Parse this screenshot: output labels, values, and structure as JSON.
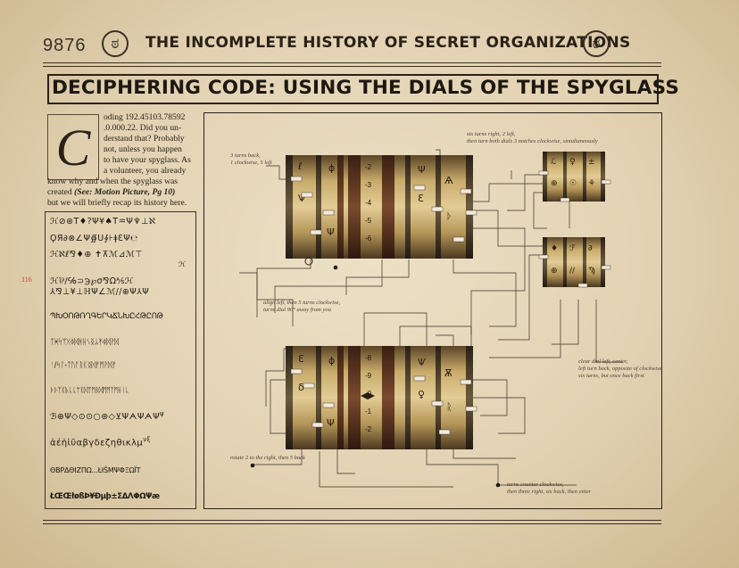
{
  "header": {
    "page_number": "9876",
    "running_title": "THE INCOMPLETE HISTORY OF SECRET ORGANIZATIONS",
    "emblem_glyph": "ಠ"
  },
  "headline": "DECIPHERING CODE: USING THE DIALS OF THE SPYGLASS",
  "intro": {
    "dropcap": "C",
    "lines": [
      "oding 192.45103.78592",
      ".0.000.22. Did you un-",
      "derstand that? Probably",
      "not, unless you happen",
      "to have your spyglass. As",
      "a volunteer, you already",
      "know why and when the spyglass was",
      "but we will briefly recap its history here."
    ],
    "created_prefix": "created ",
    "created_reference": "(See: Motion Picture, Pg 10)"
  },
  "margin_note": "116",
  "cipher_rows": [
    "ℋ⊘⊛T♦?Ψ¥♠T♒Ψ♆⊥ℵ",
    "ϘЯ∂⊗∠Ψ∯Ս∮⊦ǂƐΨ℮",
    "ℋℵℓ⅋♦⊕ ✝⊼ℳ⊿ℳ⊤",
    "ℋ",
    "ℋ⅌∕℅⊃℈℘σ⅋Ω⅍ℋ",
    "⅄⅋⊥¥⊥ℍΨ∠ℳ//⊕Ψ⅄Ψ",
    "ՊԽՕՈԹՌՂԳԵՐԿՃՆԽԸՀԹԸՈԹ",
    "ᛏᚸᛋᛘᚷᛄᛞᚻᚺᛊᛝᛦᛡᛄᛞᚹᛞ",
    "ᛌ/ᛋᛚ-ᛏᚢᚩᚱᛕᛝᛞᚡᛗᚹᛞᚡ",
    "ᚦᚦᛉᛕᚣᚳᚳᛘᛕᛞᛉᛗᛒᛞᛗᛗᛉᛗᚺᛁᚳ",
    "ℬ⊕Ψ◇⊙⊙○⊛◇⊻ΨᗅΨᗅΨ",
    "ἀέἡἱῦαβγδεζηθικλμ",
    "ΘΒΡΔΘΙΖΠΩ...ŁłŜΜΨΦΞΩΪΤ",
    "ŁŒŒłøßÞ¥Ðµþ±ΣΔΛΦΩΨæ"
  ],
  "cipher_superscripts": [
    "ψ",
    "νξ"
  ],
  "diagram": {
    "annotations": {
      "top_left": [
        "3 turns back,",
        "1 clockwise, 5 left"
      ],
      "top_right": [
        "six turns right, 2 left,",
        "then turn both dials 3 notches clockwise, simultaneously"
      ],
      "mid_left": [
        "align left, then 5 turns clockwise,",
        "turns dial 90° away from you"
      ],
      "mid_right": [
        "clear dial left, center,",
        "left turn back, opposite of clockwise",
        "six turns, but once back first"
      ],
      "bottom_left": [
        "rotate 2 to the right, then 5 back"
      ],
      "bottom_right": [
        "turns counter clockwise,",
        "then three right, six back, then enter"
      ]
    },
    "dial_glyphs_top": [
      "ℓ",
      "ϕ",
      "Ѱ",
      "Ψ",
      "Ɛ",
      "Ѧ",
      "ᚦ",
      "Ψ"
    ],
    "dial_numbers_top": [
      "-2",
      "-3",
      "-4",
      "-5",
      "-6"
    ],
    "dial_numbers_bottom": [
      "-8",
      "-9",
      "-0",
      "-1",
      "-2"
    ],
    "dial_glyphs_bottom": [
      "Ɛ",
      "ϕ",
      "δ",
      "Ѱ",
      "♀",
      "Ѫ",
      "ᚱ",
      "Ψ"
    ],
    "small_cyl_glyphs_top": [
      "ℒ",
      "♀",
      "±",
      "⊕",
      "☉",
      "⚘"
    ],
    "small_cyl_glyphs_bottom": [
      "♦",
      "ℱ",
      "∂",
      "⊕",
      "//",
      "Ϡ"
    ]
  },
  "colors": {
    "paper": "#e4d5b6",
    "ink": "#2a2118",
    "brass": "#b99a5e",
    "leather": "#6a3a26",
    "margin_note": "#b4472f"
  }
}
